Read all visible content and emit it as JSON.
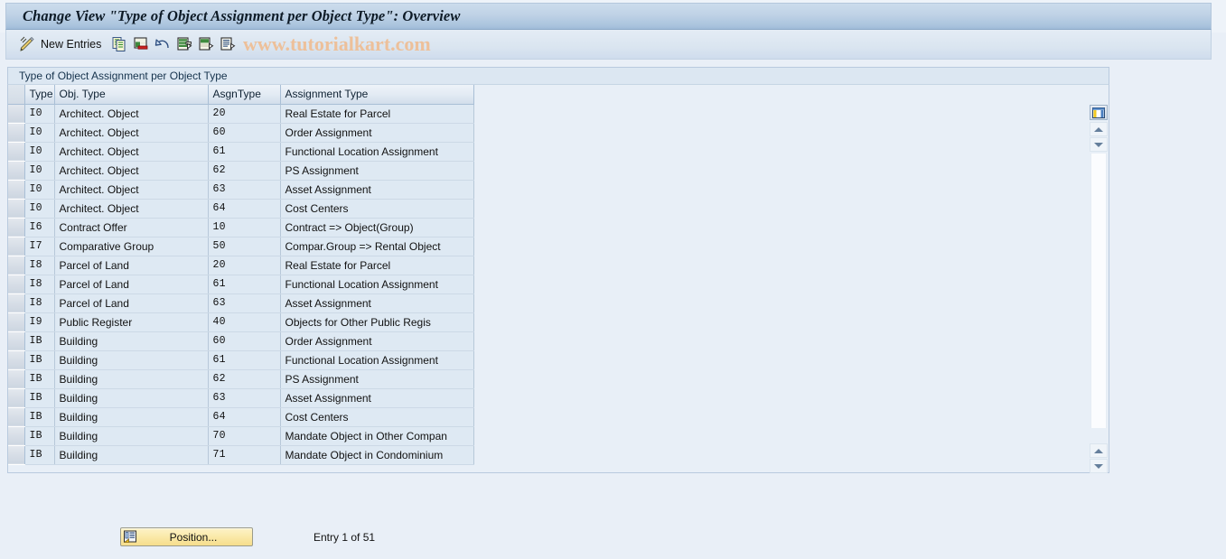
{
  "window": {
    "title": "Change View \"Type of Object Assignment per Object Type\": Overview"
  },
  "toolbar": {
    "pencil_icon": "pencil-display-change-icon",
    "new_entries_label": "New Entries",
    "copy_icon": "copy-as-icon",
    "delete_icon": "delete-row-icon",
    "undo_icon": "undo-icon",
    "prev_icon": "previous-entry-icon",
    "next_icon": "next-entry-icon",
    "select_icon": "select-layout-icon",
    "watermark": "www.tutorialkart.com",
    "watermark_color": "#edc09a"
  },
  "group": {
    "title": "Type of Object Assignment per Object Type"
  },
  "table": {
    "columns": [
      "Type",
      "Obj. Type",
      "AsgnType",
      "Assignment Type"
    ],
    "rows": [
      {
        "type": "I0",
        "obj_type": "Architect. Object",
        "asgn_type": "20",
        "assignment_type": "Real Estate for Parcel"
      },
      {
        "type": "I0",
        "obj_type": "Architect. Object",
        "asgn_type": "60",
        "assignment_type": "Order Assignment"
      },
      {
        "type": "I0",
        "obj_type": "Architect. Object",
        "asgn_type": "61",
        "assignment_type": "Functional Location Assignment"
      },
      {
        "type": "I0",
        "obj_type": "Architect. Object",
        "asgn_type": "62",
        "assignment_type": "PS Assignment"
      },
      {
        "type": "I0",
        "obj_type": "Architect. Object",
        "asgn_type": "63",
        "assignment_type": "Asset Assignment"
      },
      {
        "type": "I0",
        "obj_type": "Architect. Object",
        "asgn_type": "64",
        "assignment_type": "Cost Centers"
      },
      {
        "type": "I6",
        "obj_type": "Contract Offer",
        "asgn_type": "10",
        "assignment_type": "Contract => Object(Group)"
      },
      {
        "type": "I7",
        "obj_type": "Comparative Group",
        "asgn_type": "50",
        "assignment_type": "Compar.Group => Rental Object"
      },
      {
        "type": "I8",
        "obj_type": "Parcel of Land",
        "asgn_type": "20",
        "assignment_type": "Real Estate for Parcel"
      },
      {
        "type": "I8",
        "obj_type": "Parcel of Land",
        "asgn_type": "61",
        "assignment_type": "Functional Location Assignment"
      },
      {
        "type": "I8",
        "obj_type": "Parcel of Land",
        "asgn_type": "63",
        "assignment_type": "Asset Assignment"
      },
      {
        "type": "I9",
        "obj_type": "Public Register",
        "asgn_type": "40",
        "assignment_type": "Objects for Other Public Regis"
      },
      {
        "type": "IB",
        "obj_type": "Building",
        "asgn_type": "60",
        "assignment_type": "Order Assignment"
      },
      {
        "type": "IB",
        "obj_type": "Building",
        "asgn_type": "61",
        "assignment_type": "Functional Location Assignment"
      },
      {
        "type": "IB",
        "obj_type": "Building",
        "asgn_type": "62",
        "assignment_type": "PS Assignment"
      },
      {
        "type": "IB",
        "obj_type": "Building",
        "asgn_type": "63",
        "assignment_type": "Asset Assignment"
      },
      {
        "type": "IB",
        "obj_type": "Building",
        "asgn_type": "64",
        "assignment_type": "Cost Centers"
      },
      {
        "type": "IB",
        "obj_type": "Building",
        "asgn_type": "70",
        "assignment_type": "Mandate Object in Other Compan"
      },
      {
        "type": "IB",
        "obj_type": "Building",
        "asgn_type": "71",
        "assignment_type": "Mandate Object in Condominium"
      }
    ]
  },
  "scroll": {
    "config_icon": "column-configuration-icon",
    "up_icon": "scroll-up-icon",
    "down_icon": "scroll-down-icon",
    "bottom_up_icon": "scroll-up-icon",
    "bottom_down_icon": "scroll-down-icon"
  },
  "footer": {
    "position_label": "Position...",
    "position_icon": "position-icon",
    "entry_status": "Entry 1 of 51"
  },
  "colors": {
    "window_bg": "#e9eff7",
    "title_gradient_top": "#ccdcec",
    "title_gradient_bottom": "#9fbbd8",
    "row_bg": "#dee9f3",
    "button_yellow": "#fae9a8"
  }
}
